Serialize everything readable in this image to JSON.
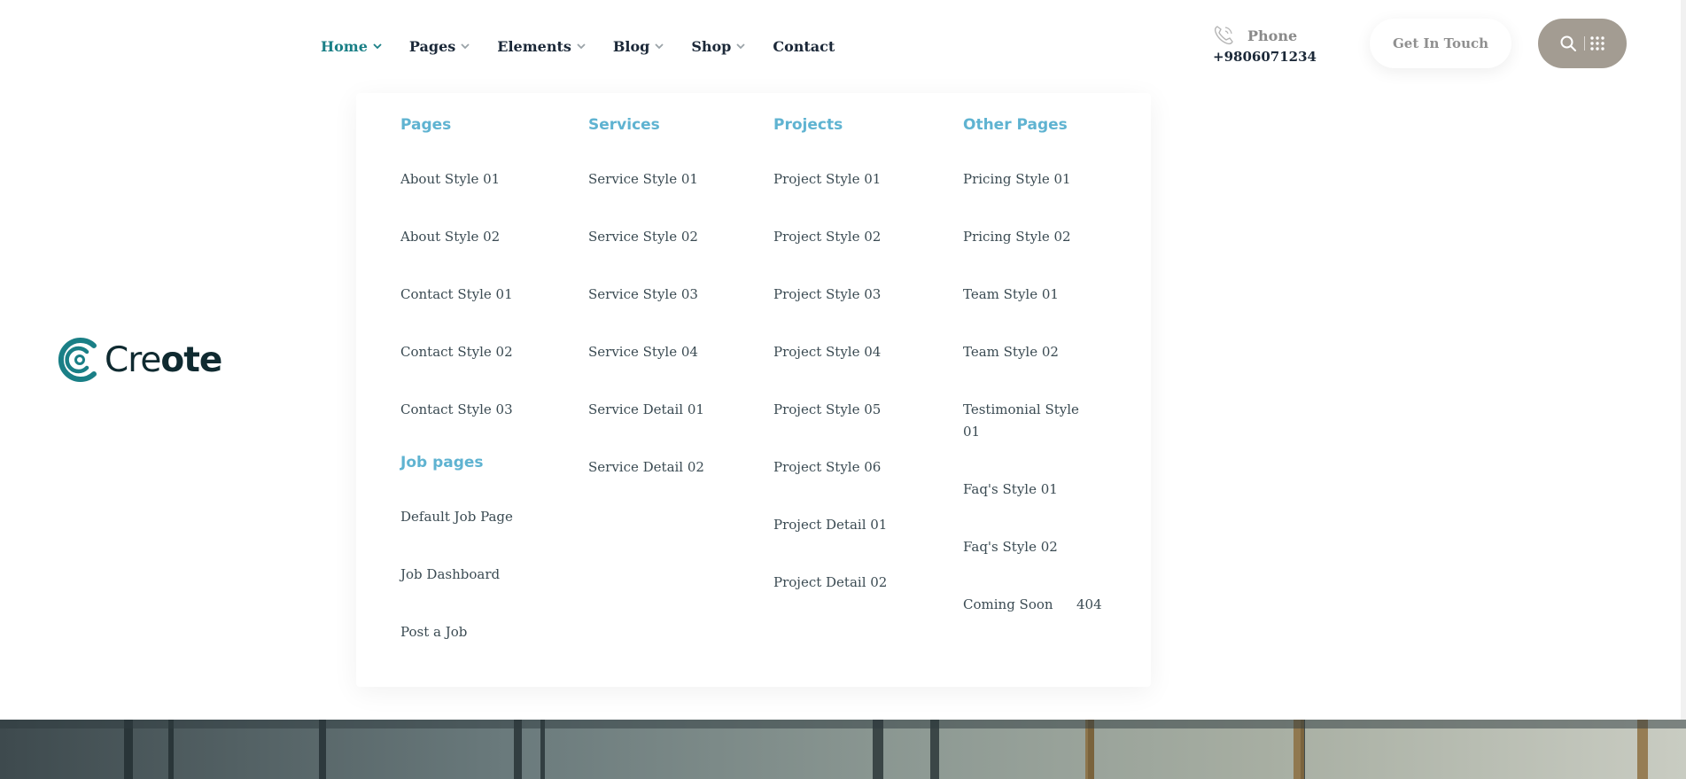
{
  "brand": {
    "logo_text_light": "Cre",
    "logo_text_bold": "ote"
  },
  "nav": [
    {
      "label": "Home",
      "active": true,
      "has_dropdown": true
    },
    {
      "label": "Pages",
      "active": false,
      "has_dropdown": true
    },
    {
      "label": "Elements",
      "active": false,
      "has_dropdown": true
    },
    {
      "label": "Blog",
      "active": false,
      "has_dropdown": true
    },
    {
      "label": "Shop",
      "active": false,
      "has_dropdown": true
    },
    {
      "label": "Contact",
      "active": false,
      "has_dropdown": false
    }
  ],
  "contact": {
    "label": "Phone",
    "number": "+9806071234",
    "icon": "phone-icon"
  },
  "cta": {
    "label": "Get In Touch"
  },
  "search": {
    "icons": [
      "search-icon",
      "grid-menu-icon"
    ]
  },
  "mega_menu": {
    "pages": {
      "heading": "Pages",
      "links": [
        "About Style 01",
        "About Style 02",
        "Contact Style 01",
        "Contact Style 02",
        "Contact Style 03"
      ],
      "sub_heading": "Job pages",
      "sub_links": [
        "Default Job Page",
        "Job Dashboard",
        "Post a Job"
      ]
    },
    "services": {
      "heading": "Services",
      "links": [
        "Service Style 01",
        "Service Style 02",
        "Service Style 03",
        "Service Style 04",
        "Service Detail 01",
        "Service Detail 02"
      ]
    },
    "projects": {
      "heading": "Projects",
      "links": [
        "Project Style 01",
        "Project Style 02",
        "Project Style 03",
        "Project Style 04",
        "Project Style 05",
        "Project Style 06",
        "Project Detail 01",
        "Project Detail 02"
      ]
    },
    "other": {
      "heading": "Other Pages",
      "links": [
        "Pricing Style 01",
        "Pricing Style 02",
        "Team Style 01",
        "Team Style 02",
        "Testimonial Style",
        "01",
        "Faq's Style 01",
        "Faq's Style 02",
        "Coming Soon",
        "404"
      ]
    }
  },
  "colors": {
    "accent": "#1a7f86",
    "heading_blue": "#5fb3d1",
    "pill_bg": "#a39c92"
  }
}
